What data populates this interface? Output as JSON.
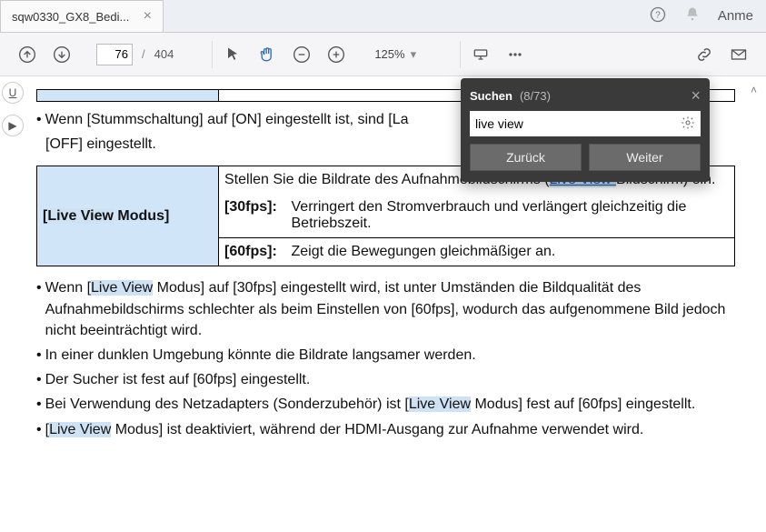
{
  "tab": {
    "title": "sqw0330_GX8_Bedi..."
  },
  "toolbar": {
    "page_current": "76",
    "page_total": "404",
    "zoom": "125%"
  },
  "top": {
    "login": "Anme"
  },
  "find": {
    "title": "Suchen",
    "count": "(8/73)",
    "query": "live view",
    "back": "Zurück",
    "next": "Weiter"
  },
  "content": {
    "b1": "Wenn [Stummschaltung] auf [ON] eingestellt ist, sind [La",
    "b1b": "[OFF] eingestellt.",
    "table": {
      "mode_label_pre": "[",
      "mode_label_hl": "Live View",
      "mode_label_post": " Modus]",
      "desc_pre": "Stellen Sie die Bildrate des Aufnahmebildschirms (",
      "desc_hl": "Live View-",
      "desc_post": "Bildschirm) ein.",
      "r1_label": "[30fps]:",
      "r1_text": "Verringert den Stromverbrauch und verlängert gleichzeitig die Betriebszeit.",
      "r2_label": "[60fps]:",
      "r2_text": "Zeigt die Bewegungen gleichmäßiger an."
    },
    "b2_pre": "Wenn [",
    "b2_hl": "Live View",
    "b2_post": " Modus] auf [30fps] eingestellt wird, ist unter Umständen die Bildqualität des Aufnahmebildschirms schlechter als beim Einstellen von [60fps], wodurch das aufgenommene Bild jedoch nicht beeinträchtigt wird.",
    "b3": "In einer dunklen Umgebung könnte die Bildrate langsamer werden.",
    "b4": "Der Sucher ist fest auf [60fps] eingestellt.",
    "b5_pre": "Bei Verwendung des Netzadapters (Sonderzubehör) ist [",
    "b5_hl": "Live View",
    "b5_post": " Modus] fest auf [60fps] eingestellt.",
    "b6_pre": "[",
    "b6_hl": "Live View",
    "b6_post": " Modus] ist deaktiviert, während der HDMI-Ausgang zur Aufnahme verwendet wird."
  }
}
